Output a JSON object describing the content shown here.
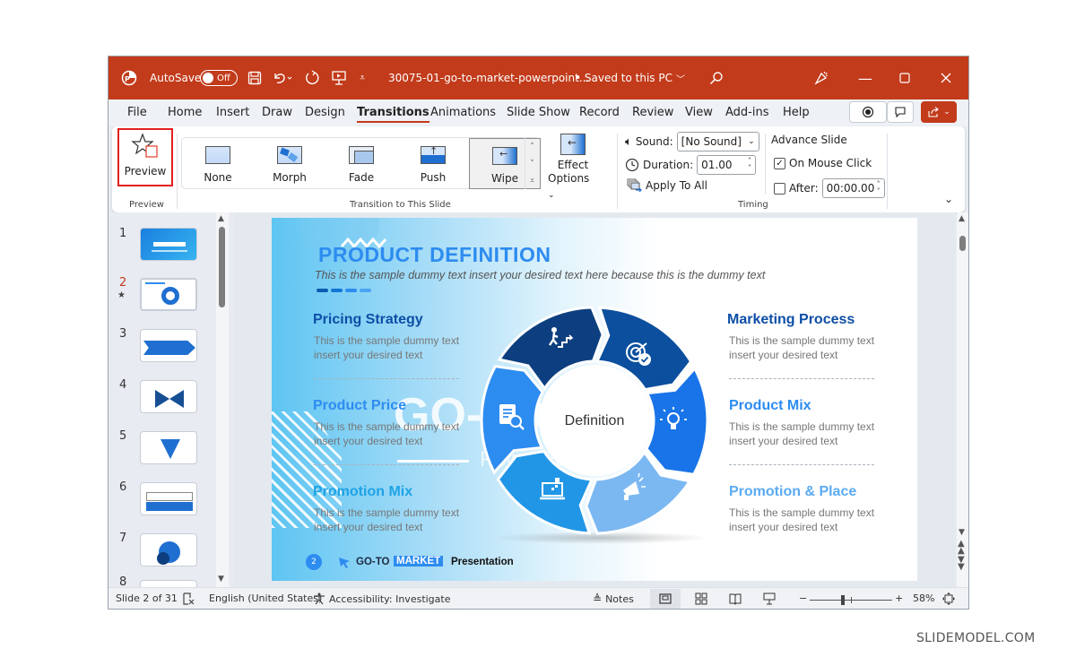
{
  "titlebar": {
    "autosave_label": "AutoSave",
    "autosave_state": "Off",
    "filename": "30075-01-go-to-market-powerpoint...",
    "save_status": "• Saved to this PC",
    "icons": [
      "powerpoint-logo-icon",
      "save-icon",
      "undo-icon",
      "redo-icon",
      "present-icon",
      "customize-icon",
      "search-icon",
      "designer-icon",
      "minimize-icon",
      "maximize-icon",
      "close-icon"
    ]
  },
  "menu": {
    "items": [
      "File",
      "Home",
      "Insert",
      "Draw",
      "Design",
      "Transitions",
      "Animations",
      "Slide Show",
      "Record",
      "Review",
      "View",
      "Add-ins",
      "Help"
    ],
    "active": "Transitions"
  },
  "ribbon": {
    "preview": {
      "button_label": "Preview",
      "group_label": "Preview"
    },
    "transitions": {
      "items": [
        "None",
        "Morph",
        "Fade",
        "Push",
        "Wipe"
      ],
      "selected": "Wipe",
      "group_label": "Transition to This Slide",
      "effect_options_line1": "Effect",
      "effect_options_line2": "Options"
    },
    "timing": {
      "sound_label": "Sound:",
      "sound_value": "[No Sound]",
      "duration_label": "Duration:",
      "duration_value": "01.00",
      "apply_all_label": "Apply To All",
      "advance_label": "Advance Slide",
      "on_mouse_click_label": "On Mouse Click",
      "on_mouse_click_checked": true,
      "after_label": "After:",
      "after_checked": false,
      "after_value": "00:00.00",
      "group_label": "Timing"
    }
  },
  "slides_pane": {
    "numbers": [
      "1",
      "2",
      "3",
      "4",
      "5",
      "6",
      "7",
      "8"
    ],
    "selected": "2",
    "selected_color": "#c23b1b"
  },
  "slide": {
    "title": "PRODUCT DEFINITION",
    "subtitle": "This is the sample dummy text insert your desired text here because this is the dummy text",
    "center_label": "Definition",
    "watermark_big": "GO-TO",
    "watermark_small": "PowerPoint",
    "left_items": [
      {
        "heading": "Pricing Strategy",
        "line1": "This is the sample dummy text",
        "line2": "insert your desired text",
        "color": "#0d4ea6"
      },
      {
        "heading": "Product Price",
        "line1": "This is the sample dummy text",
        "line2": "insert your desired text",
        "color": "#2d8cf0"
      },
      {
        "heading": "Promotion Mix",
        "line1": "This is the sample dummy text",
        "line2": "insert your desired text",
        "color": "#1ea3e6"
      }
    ],
    "right_items": [
      {
        "heading": "Marketing Process",
        "line1": "This is the sample dummy text",
        "line2": "insert your desired text",
        "color": "#0d4ea6"
      },
      {
        "heading": "Product Mix",
        "line1": "This is the sample dummy text",
        "line2": "insert your desired text",
        "color": "#2d8cf0"
      },
      {
        "heading": "Promotion & Place",
        "line1": "This is the sample dummy text",
        "line2": "insert your desired text",
        "color": "#5aabf2"
      }
    ],
    "footer": {
      "page": "2",
      "brand_a": "GO-TO",
      "brand_b": "MARKET",
      "brand_c": "Presentation"
    },
    "ring_colors": [
      "#0d3f80",
      "#0b4f9e",
      "#1874e8",
      "#7bb8f2",
      "#2196e6",
      "#2d8cf0"
    ]
  },
  "statusbar": {
    "slide_info": "Slide 2 of 31",
    "language": "English (United States)",
    "accessibility": "Accessibility: Investigate",
    "notes_label": "Notes",
    "zoom": "58%",
    "zoom_fraction": 0.4
  },
  "watermark": "SLIDEMODEL.COM"
}
